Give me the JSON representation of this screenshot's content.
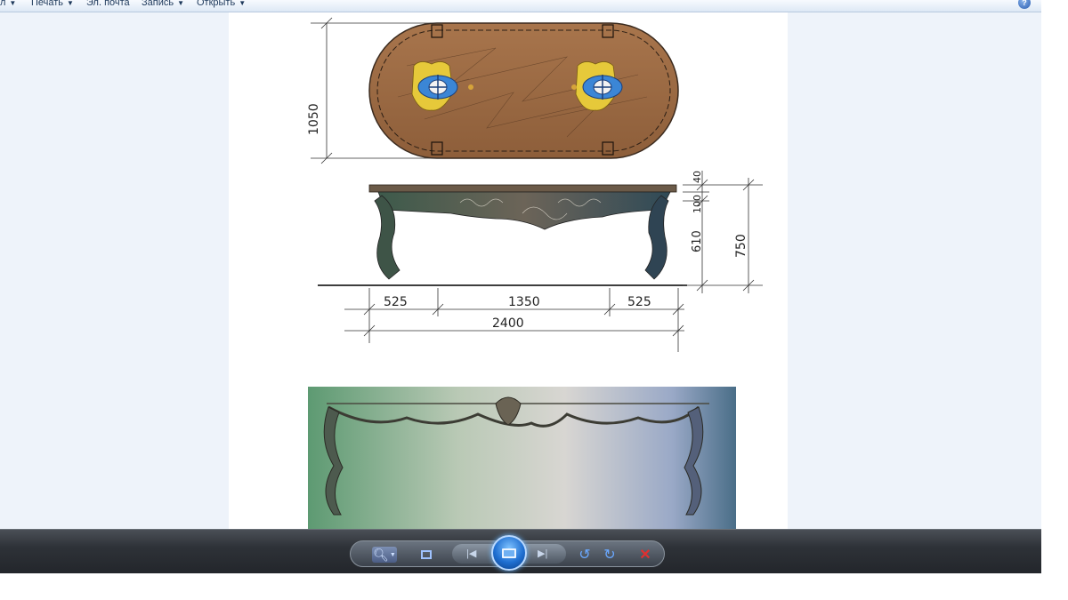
{
  "menubar": {
    "items": [
      {
        "label": "л",
        "has_arrow": true
      },
      {
        "label": "Печать",
        "has_arrow": true
      },
      {
        "label": "Эл. почта",
        "has_arrow": false
      },
      {
        "label": "Запись",
        "has_arrow": true
      },
      {
        "label": "Открыть",
        "has_arrow": true
      }
    ],
    "help_icon": "?"
  },
  "drawing": {
    "dim_top_height": "1050",
    "dim_40": "40",
    "dim_100": "100",
    "dim_610": "610",
    "dim_750": "750",
    "dim_left": "525",
    "dim_mid": "1350",
    "dim_right": "525",
    "dim_total": "2400"
  },
  "toolbar": {
    "buttons": [
      "zoom-icon",
      "fit-window-icon",
      "previous-icon",
      "slideshow-icon",
      "next-icon",
      "rotate-left-icon",
      "rotate-right-icon",
      "delete-icon"
    ]
  },
  "colors": {
    "tabletop": "#9b6a44",
    "toolbar": "#2e3238",
    "accent": "#1f6fd1",
    "delete": "#e03030"
  }
}
